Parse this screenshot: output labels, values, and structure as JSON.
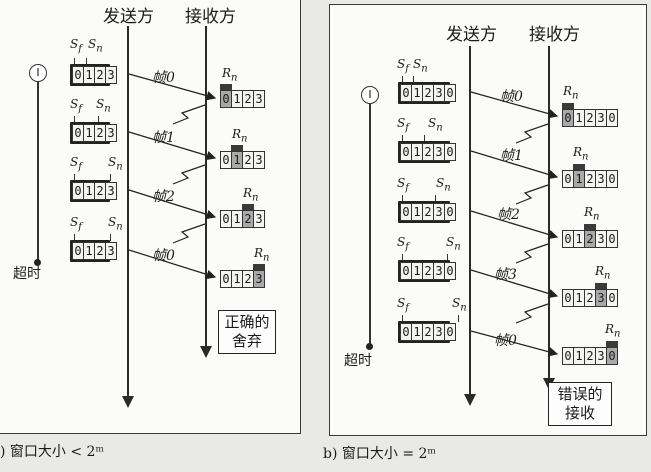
{
  "panel_a": {
    "sender": "发送方",
    "receiver": "接收方",
    "timeout": "超时",
    "timer": "I",
    "caption": ") 窗口大小 < 2ᵐ",
    "note_line1": "正确的",
    "note_line2": "舍弃",
    "frames": [
      "帧0",
      "帧1",
      "帧2",
      "帧0"
    ],
    "sender_digits": [
      "0",
      "1",
      "2",
      "3"
    ],
    "receiver_digits": [
      "0",
      "1",
      "2",
      "3"
    ],
    "sf": "S",
    "sf_sub": "f",
    "sn": "S",
    "sn_sub": "n",
    "rn": "R",
    "rn_sub": "n"
  },
  "panel_b": {
    "sender": "发送方",
    "receiver": "接收方",
    "timeout": "超时",
    "timer": "I",
    "caption": "b) 窗口大小 = 2ᵐ",
    "note_line1": "错误的",
    "note_line2": "接收",
    "frames": [
      "帧0",
      "帧1",
      "帧2",
      "帧3",
      "帧0"
    ],
    "sender_digits": [
      "0",
      "1",
      "2",
      "3",
      "0"
    ],
    "receiver_digits": [
      "0",
      "1",
      "2",
      "3",
      "0"
    ],
    "sf": "S",
    "sf_sub": "f",
    "sn": "S",
    "sn_sub": "n",
    "rn": "R",
    "rn_sub": "n"
  }
}
